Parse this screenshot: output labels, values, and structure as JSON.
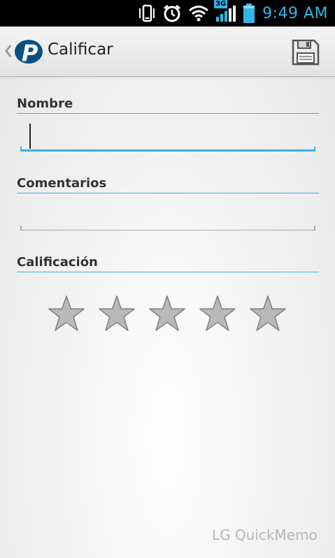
{
  "status_bar": {
    "time": "9:49 AM",
    "network_type": "3G",
    "icons": [
      "vibrate-icon",
      "alarm-icon",
      "wifi-icon",
      "3g-icon",
      "signal-icon",
      "battery-icon"
    ]
  },
  "action_bar": {
    "title": "Calificar",
    "logo_letter": "P",
    "save_icon": "floppy-disk-icon"
  },
  "form": {
    "name_label": "Nombre",
    "name_value": "",
    "comments_label": "Comentarios",
    "comments_value": "",
    "rating_label": "Calificación",
    "rating": {
      "value": 0,
      "max": 5
    }
  },
  "watermark": "LG QuickMemo",
  "colors": {
    "accent": "#33b5e5",
    "star_fill": "#b9b9b9",
    "star_stroke": "#7d7d7d"
  }
}
